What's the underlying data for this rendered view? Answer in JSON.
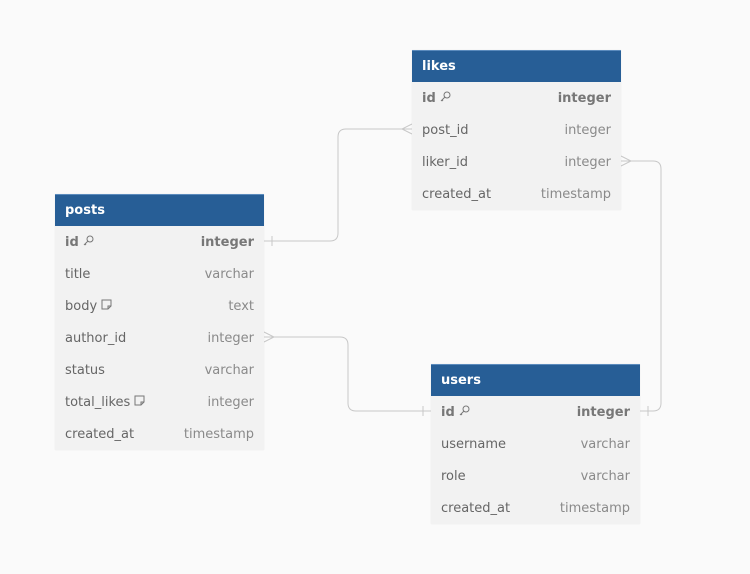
{
  "tables": [
    {
      "name": "posts",
      "fields": [
        {
          "name": "id",
          "type": "integer",
          "pk": true,
          "icon": "key-icon"
        },
        {
          "name": "title",
          "type": "varchar"
        },
        {
          "name": "body",
          "type": "text",
          "icon": "note-icon"
        },
        {
          "name": "author_id",
          "type": "integer"
        },
        {
          "name": "status",
          "type": "varchar"
        },
        {
          "name": "total_likes",
          "type": "integer",
          "icon": "note-icon"
        },
        {
          "name": "created_at",
          "type": "timestamp"
        }
      ]
    },
    {
      "name": "likes",
      "fields": [
        {
          "name": "id",
          "type": "integer",
          "pk": true,
          "icon": "key-icon"
        },
        {
          "name": "post_id",
          "type": "integer"
        },
        {
          "name": "liker_id",
          "type": "integer"
        },
        {
          "name": "created_at",
          "type": "timestamp"
        }
      ]
    },
    {
      "name": "users",
      "fields": [
        {
          "name": "id",
          "type": "integer",
          "pk": true,
          "icon": "key-icon"
        },
        {
          "name": "username",
          "type": "varchar"
        },
        {
          "name": "role",
          "type": "varchar"
        },
        {
          "name": "created_at",
          "type": "timestamp"
        }
      ]
    }
  ],
  "relationships": [
    {
      "from": "likes.post_id",
      "to": "posts.id",
      "type": "many-to-one"
    },
    {
      "from": "likes.liker_id",
      "to": "users.id",
      "type": "many-to-one"
    },
    {
      "from": "posts.author_id",
      "to": "users.id",
      "type": "many-to-one"
    }
  ],
  "colors": {
    "header": "#275e96",
    "line": "#c8c8c8"
  }
}
